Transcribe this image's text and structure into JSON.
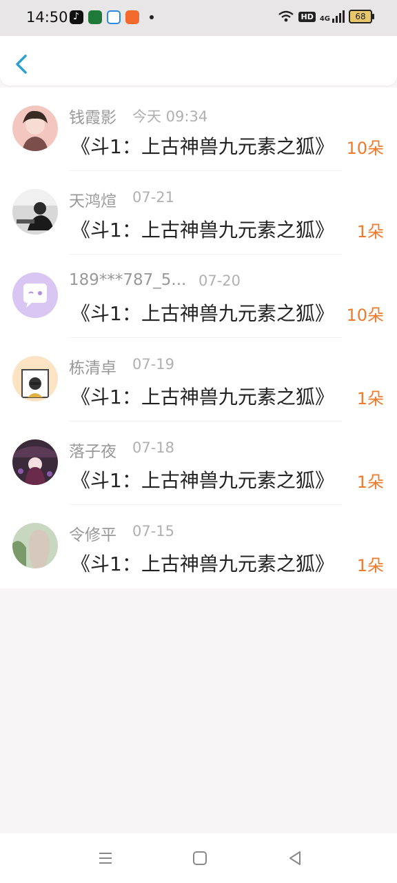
{
  "status_bar": {
    "time": "14:50",
    "network": "4G",
    "hd": "HD",
    "battery": "68"
  },
  "header": {
    "back_icon": "chevron-left-icon"
  },
  "colors": {
    "accent": "#2a9fd6",
    "count": "#f07a2c"
  },
  "gifts": [
    {
      "name": "钱霞影",
      "date": "今天 09:34",
      "title": "《斗1：上古神兽九元素之狐》",
      "count": "10朵"
    },
    {
      "name": "天鸿煊",
      "date": "07-21",
      "title": "《斗1：上古神兽九元素之狐》",
      "count": "1朵"
    },
    {
      "name": "189***787_5...",
      "date": "07-20",
      "title": "《斗1：上古神兽九元素之狐》",
      "count": "10朵"
    },
    {
      "name": "栋清卓",
      "date": "07-19",
      "title": "《斗1：上古神兽九元素之狐》",
      "count": "1朵"
    },
    {
      "name": "落子夜",
      "date": "07-18",
      "title": "《斗1：上古神兽九元素之狐》",
      "count": "1朵"
    },
    {
      "name": "令修平",
      "date": "07-15",
      "title": "《斗1：上古神兽九元素之狐》",
      "count": "1朵"
    }
  ],
  "nav": {
    "menu_icon": "menu-icon",
    "home_icon": "square-icon",
    "back_icon": "triangle-back-icon"
  }
}
